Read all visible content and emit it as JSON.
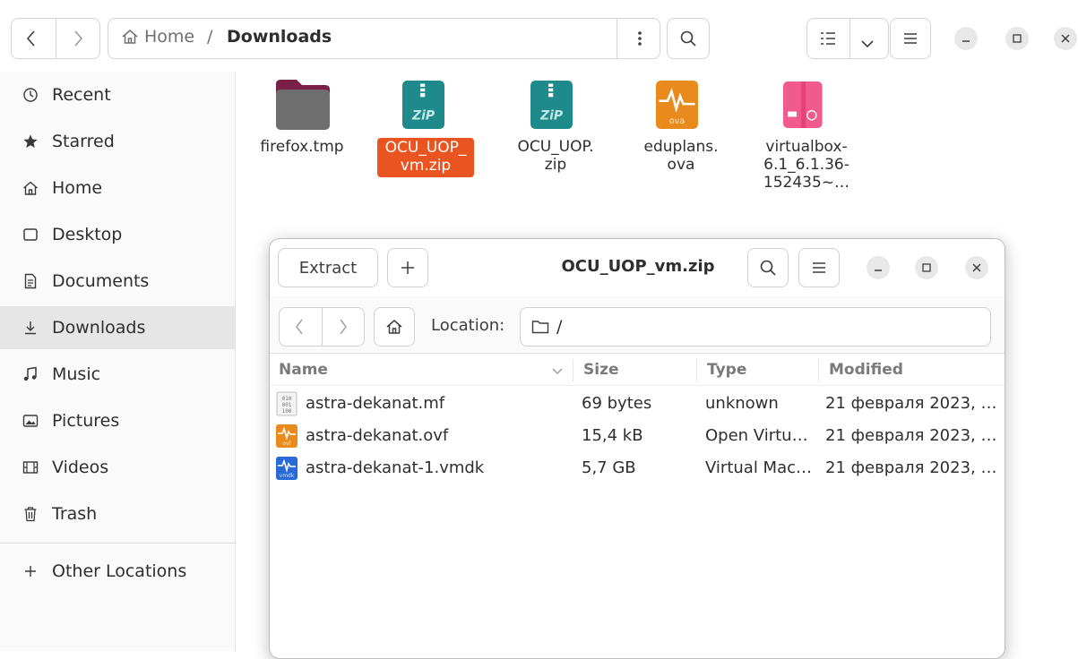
{
  "header": {
    "breadcrumb_home": "Home",
    "breadcrumb_sep": "/",
    "breadcrumb_current": "Downloads"
  },
  "sidebar": {
    "items": [
      {
        "label": "Recent",
        "icon": "clock-icon"
      },
      {
        "label": "Starred",
        "icon": "star-icon"
      },
      {
        "label": "Home",
        "icon": "home-icon"
      },
      {
        "label": "Desktop",
        "icon": "desktop-icon"
      },
      {
        "label": "Documents",
        "icon": "document-icon"
      },
      {
        "label": "Downloads",
        "icon": "download-icon",
        "active": true
      },
      {
        "label": "Music",
        "icon": "music-icon"
      },
      {
        "label": "Pictures",
        "icon": "picture-icon"
      },
      {
        "label": "Videos",
        "icon": "video-icon"
      },
      {
        "label": "Trash",
        "icon": "trash-icon"
      }
    ],
    "other_locations": "Other Locations"
  },
  "files": [
    {
      "lines": [
        "firefox.tmp"
      ],
      "icon": "folder-icon"
    },
    {
      "lines": [
        "OCU_UOP_",
        "vm.zip"
      ],
      "icon": "zip-file-icon",
      "selected": true
    },
    {
      "lines": [
        "OCU_UOP.",
        "zip"
      ],
      "icon": "zip-file-icon"
    },
    {
      "lines": [
        "eduplans.",
        "ova"
      ],
      "icon": "ova-file-icon"
    },
    {
      "lines": [
        "virtualbox-",
        "6.1_6.1.36-",
        "152435~…"
      ],
      "icon": "deb-package-icon"
    }
  ],
  "archive": {
    "extract_label": "Extract",
    "title": "OCU_UOP_vm.zip",
    "location_label": "Location:",
    "location_value": "/",
    "columns": {
      "name": "Name",
      "size": "Size",
      "type": "Type",
      "modified": "Modified"
    },
    "rows": [
      {
        "name": "astra-dekanat.mf",
        "size": "69 bytes",
        "type": "unknown",
        "modified": "21 февраля 2023, …",
        "icon": "binary-file-icon"
      },
      {
        "name": "astra-dekanat.ovf",
        "size": "15,4 kB",
        "type": "Open Virtu…",
        "modified": "21 февраля 2023, …",
        "icon": "ovf-file-icon"
      },
      {
        "name": "astra-dekanat-1.vmdk",
        "size": "5,7 GB",
        "type": "Virtual Mac…",
        "modified": "21 февраля 2023, …",
        "icon": "vmdk-file-icon"
      }
    ]
  },
  "colors": {
    "accent": "#e95420",
    "zip": "#1e8a8c",
    "ova": "#e98a1d",
    "deb": "#f05a8c",
    "vmdk": "#2a6ad8"
  }
}
